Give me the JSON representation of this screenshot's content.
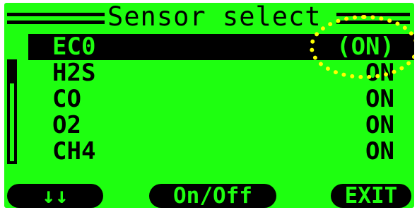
{
  "title": "Sensor select",
  "sensors": [
    {
      "name": "EC0",
      "state": "(ON)"
    },
    {
      "name": "H2S",
      "state": "ON"
    },
    {
      "name": "CO",
      "state": "ON"
    },
    {
      "name": "O2",
      "state": "ON"
    },
    {
      "name": "CH4",
      "state": "ON"
    }
  ],
  "softkeys": {
    "down": "↓↓",
    "onoff": "On/Off",
    "exit": "EXIT"
  },
  "colors": {
    "screen": "#1eff10",
    "text": "#000000",
    "highlight": "#ffff00"
  }
}
